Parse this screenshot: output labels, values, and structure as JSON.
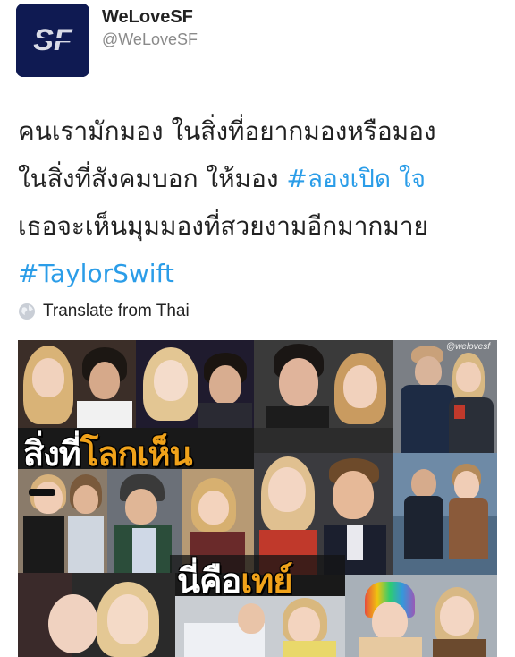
{
  "account": {
    "display_name": "WeLoveSF",
    "handle": "@WeLoveSF",
    "avatar_text": "SF"
  },
  "tweet": {
    "line1": "คนเรามักมอง ในสิ่งที่อยากมองหรือมอง",
    "line2_text": "ในสิ่งที่สังคมบอก ให้มอง ",
    "line2_hashtag": "#ลองเปิด ใจ",
    "line3": "เธอจะเห็นมุมมองที่สวยงามอีกมากมาย",
    "line4_hashtag": "#TaylorSwift"
  },
  "translate": {
    "label": "Translate from Thai",
    "icon": "globe-icon"
  },
  "media": {
    "watermark": "@welovesf",
    "caption_top_white": "สิ่งที่",
    "caption_top_orange": "โลกเห็น",
    "caption_bottom_white": "นี่คือ",
    "caption_bottom_orange": "เทย์"
  },
  "colors": {
    "hashtag": "#2b9de8",
    "avatar_bg": "#0f1a52",
    "caption_orange": "#f0a21a"
  }
}
